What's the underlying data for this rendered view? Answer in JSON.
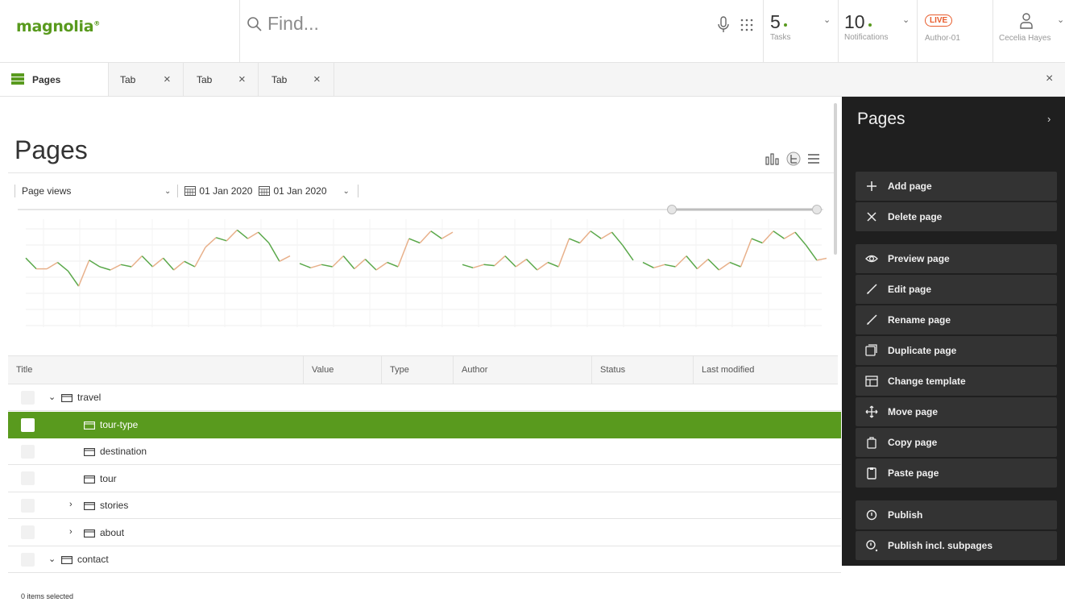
{
  "header": {
    "logo": "magnolia",
    "logo_mark": "®",
    "search_placeholder": "Find...",
    "tasks": {
      "count": "5",
      "label": "Tasks"
    },
    "notifications": {
      "count": "10",
      "label": "Notifications"
    },
    "env": {
      "badge": "LIVE",
      "label": "Author-01"
    },
    "user": {
      "name": "Cecelia Hayes"
    },
    "accent": "#599a1e"
  },
  "tabs": [
    {
      "label": "Pages",
      "icon": "pages-icon",
      "active": true
    },
    {
      "label": "Tab"
    },
    {
      "label": "Tab"
    },
    {
      "label": "Tab"
    }
  ],
  "main": {
    "title": "Pages",
    "filters": {
      "metric": "Page views",
      "date_from": "01 Jan 2020",
      "date_to": "01 Jan 2020"
    }
  },
  "chart_data": {
    "type": "line",
    "title": "",
    "xlabel": "",
    "ylabel": "",
    "ylim": [
      0,
      100
    ],
    "up_color": "#e8b08a",
    "down_color": "#5aa84a",
    "segments": [
      [
        64,
        54,
        54,
        60,
        52,
        38,
        62,
        56,
        53,
        58,
        56,
        66,
        56,
        64,
        53,
        61,
        56,
        74,
        83,
        80,
        90,
        82,
        88,
        78,
        61,
        66
      ],
      [
        59,
        55,
        58,
        56,
        66,
        54,
        63,
        53,
        60,
        56,
        82,
        78,
        89,
        82,
        88
      ],
      [
        58,
        55,
        58,
        57,
        66,
        56,
        63,
        53,
        60,
        56,
        82,
        78,
        89,
        82,
        88,
        76,
        62
      ],
      [
        60,
        55,
        58,
        56,
        66,
        54,
        63,
        53,
        60,
        56,
        82,
        78,
        89,
        82,
        88,
        76,
        62,
        64,
        70,
        66,
        84
      ]
    ]
  },
  "table": {
    "columns": [
      "Title",
      "Value",
      "Type",
      "Author",
      "Status",
      "Last modified"
    ],
    "rows": [
      {
        "name": "travel",
        "level": 0,
        "expander": "open"
      },
      {
        "name": "tour-type",
        "level": 1,
        "expander": "",
        "selected": true
      },
      {
        "name": "destination",
        "level": 1,
        "expander": ""
      },
      {
        "name": "tour",
        "level": 1,
        "expander": ""
      },
      {
        "name": "stories",
        "level": 0,
        "expander": "closed"
      },
      {
        "name": "about",
        "level": 0,
        "expander": "closed"
      },
      {
        "name": "contact",
        "level": 0,
        "expander": "open"
      }
    ],
    "selection_status": "0 items selected"
  },
  "panel": {
    "title": "Pages",
    "groups": [
      [
        {
          "label": "Add page",
          "icon": "plus-icon"
        },
        {
          "label": "Delete page",
          "icon": "close-icon"
        }
      ],
      [
        {
          "label": "Preview page",
          "icon": "eye-icon"
        },
        {
          "label": "Edit page",
          "icon": "pencil-icon"
        },
        {
          "label": "Rename page",
          "icon": "pencil-icon"
        },
        {
          "label": "Duplicate page",
          "icon": "duplicate-icon"
        },
        {
          "label": "Change template",
          "icon": "template-icon"
        },
        {
          "label": "Move page",
          "icon": "move-icon"
        },
        {
          "label": "Copy page",
          "icon": "copy-icon"
        },
        {
          "label": "Paste page",
          "icon": "clipboard-icon"
        }
      ],
      [
        {
          "label": "Publish",
          "icon": "publish-icon"
        },
        {
          "label": "Publish incl. subpages",
          "icon": "publish-subpages-icon"
        }
      ]
    ]
  }
}
